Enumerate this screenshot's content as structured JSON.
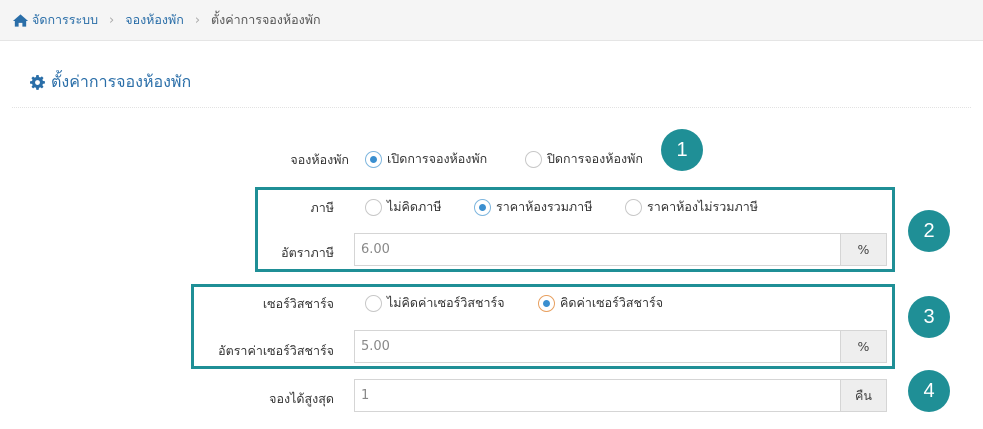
{
  "breadcrumb": {
    "items": [
      "จัดการระบบ",
      "จองห้องพัก"
    ],
    "current": "ตั้งค่าการจองห้องพัก",
    "separator": "›"
  },
  "page": {
    "title": "ตั้งค่าการจองห้องพัก"
  },
  "booking": {
    "label": "จองห้องพัก",
    "options": [
      "เปิดการจองห้องพัก",
      "ปิดการจองห้องพัก"
    ],
    "selected": 0
  },
  "tax": {
    "label": "ภาษี",
    "options": [
      "ไม่คิดภาษี",
      "ราคาห้องรวมภาษี",
      "ราคาห้องไม่รวมภาษี"
    ],
    "selected": 1,
    "rate_label": "อัตราภาษี",
    "rate_value": "6.00",
    "rate_unit": "%"
  },
  "service_charge": {
    "label": "เซอร์วิสชาร์จ",
    "options": [
      "ไม่คิดค่าเซอร์วิสชาร์จ",
      "คิดค่าเซอร์วิสชาร์จ"
    ],
    "selected": 1,
    "rate_label": "อัตราค่าเซอร์วิสชาร์จ",
    "rate_value": "5.00",
    "rate_unit": "%"
  },
  "max_booking": {
    "label": "จองได้สูงสุด",
    "value": "1",
    "unit": "คืน"
  },
  "badges": [
    "1",
    "2",
    "3",
    "4"
  ],
  "colors": {
    "accent": "#1f8f96",
    "link": "#2a6ea8"
  }
}
